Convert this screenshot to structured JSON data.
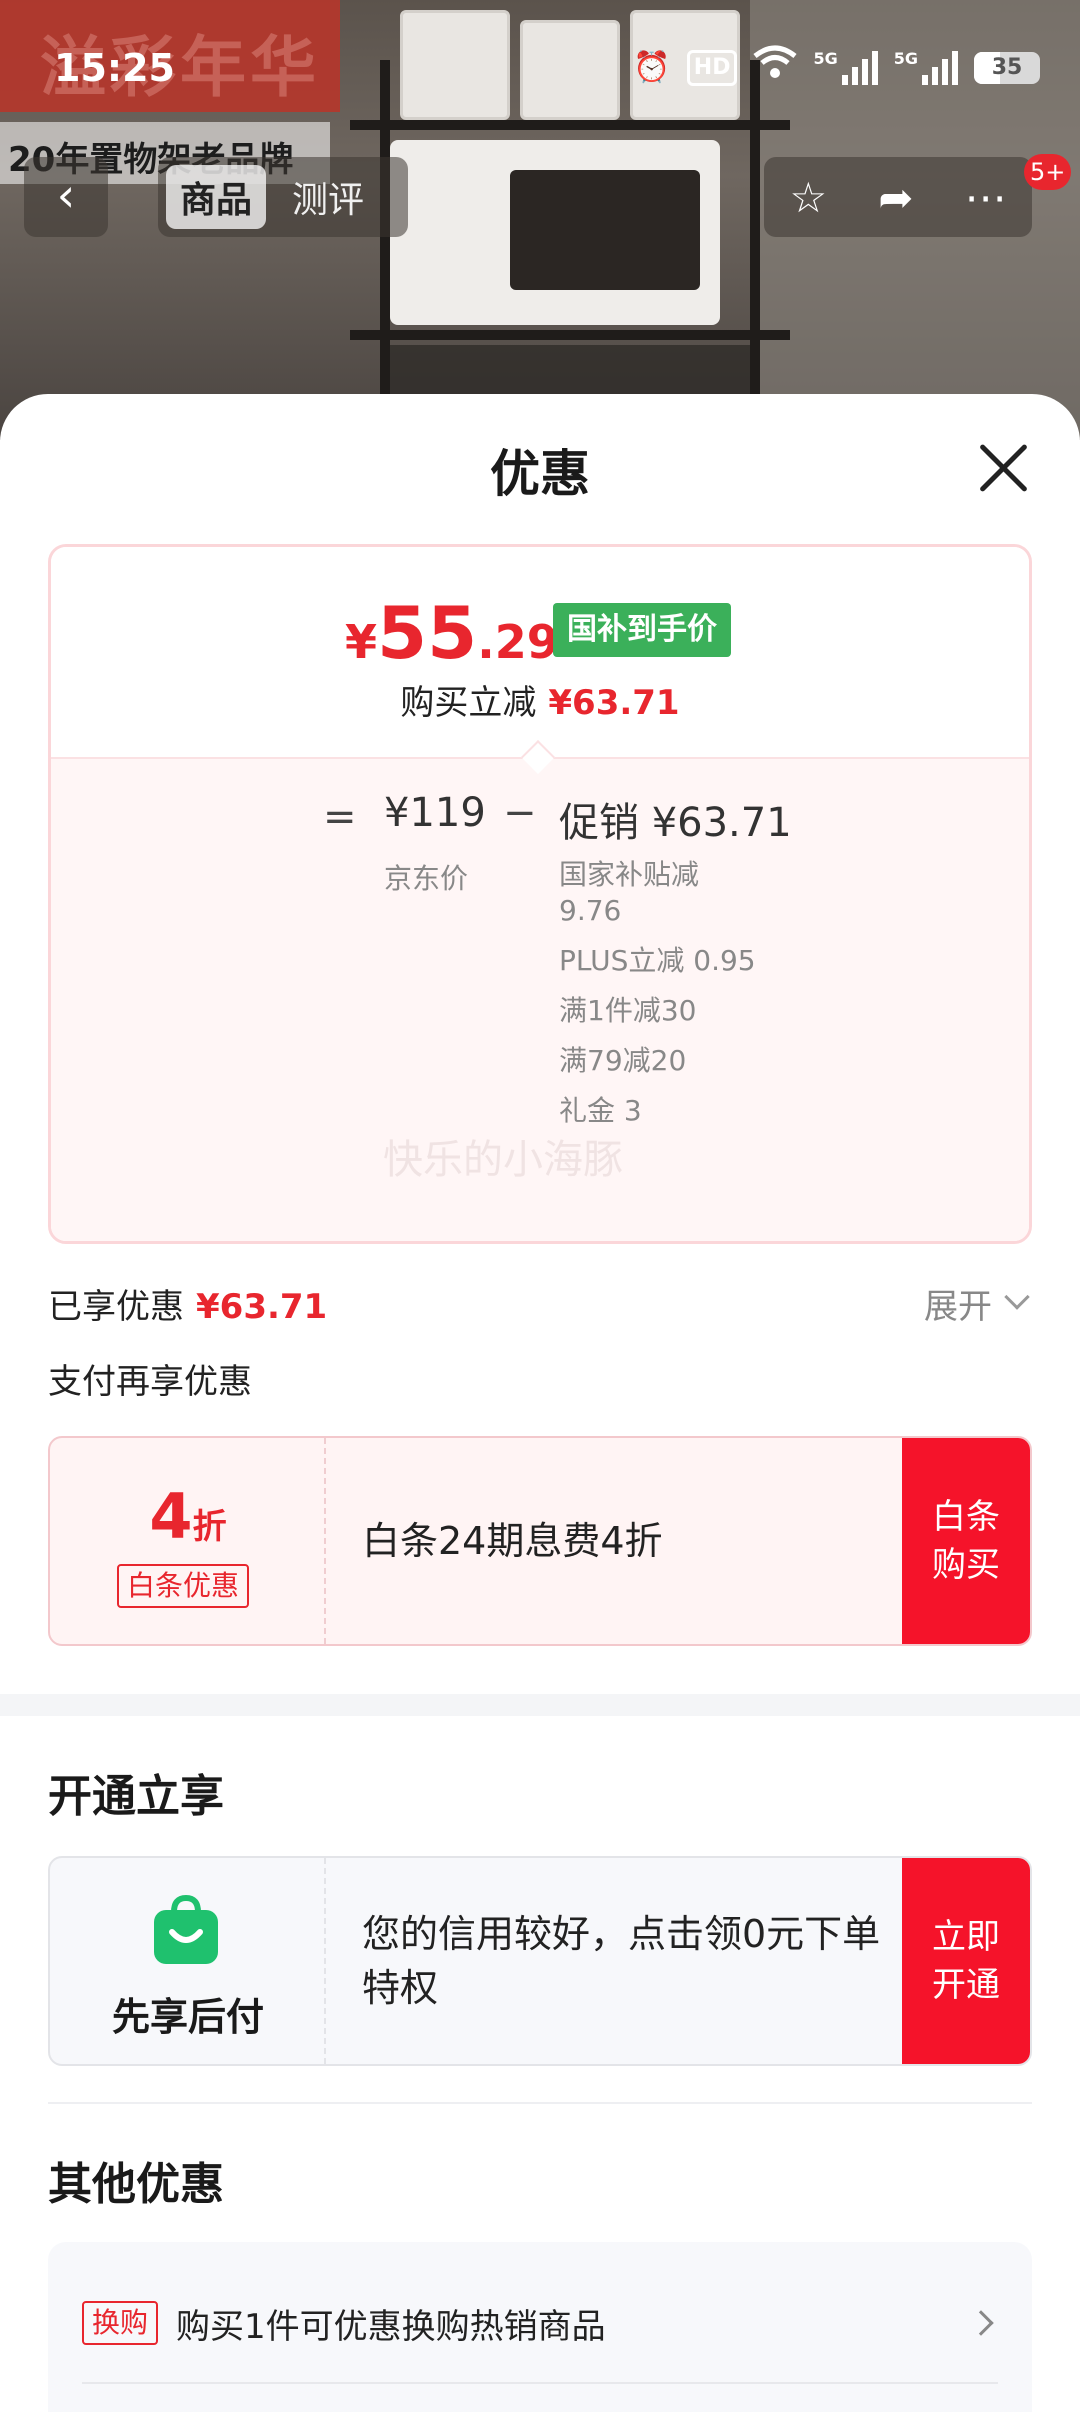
{
  "status_bar": {
    "time": "15:25",
    "hd": "HD",
    "sig1": "5G",
    "sig2": "5G",
    "battery": "35"
  },
  "background": {
    "banner": "溢彩年华",
    "brand_text": "20年置物架老品牌"
  },
  "top_nav": {
    "tabs": [
      "商品",
      "测评"
    ],
    "badge": "5+"
  },
  "sheet": {
    "title": "优惠",
    "price": {
      "currency": "¥",
      "integer": "55",
      "decimal": ".29",
      "tag": "国补到手价",
      "reduce_label": "购买立减",
      "reduce_value": "¥63.71"
    },
    "calc": {
      "equals": "=",
      "jd_price": "¥119",
      "jd_label": "京东价",
      "minus": "−",
      "promo": "促销 ¥63.71",
      "promo_items": [
        "国家补贴减 9.76",
        "PLUS立减 0.95",
        "满1件减30",
        "满79减20",
        "礼金 3"
      ]
    },
    "watermark": "快乐的小海豚",
    "enjoyed_label": "已享优惠",
    "enjoyed_value": "¥63.71",
    "expand": "展开",
    "pay_more": "支付再享优惠",
    "baitiao": {
      "num": "4",
      "unit": "折",
      "tag": "白条优惠",
      "text": "白条24期息费4折",
      "button": "白条购买"
    },
    "section_open": "开通立享",
    "paylater": {
      "label": "先享后付",
      "text": "您的信用较好，点击领0元下单特权",
      "button": "立即开通"
    },
    "section_other": "其他优惠",
    "other": {
      "tag": "换购",
      "text": "购买1件可优惠换购热销商品"
    }
  },
  "colors": {
    "accent_red": "#e8262e",
    "button_red": "#f5132a",
    "tag_green": "#3bb05a"
  }
}
